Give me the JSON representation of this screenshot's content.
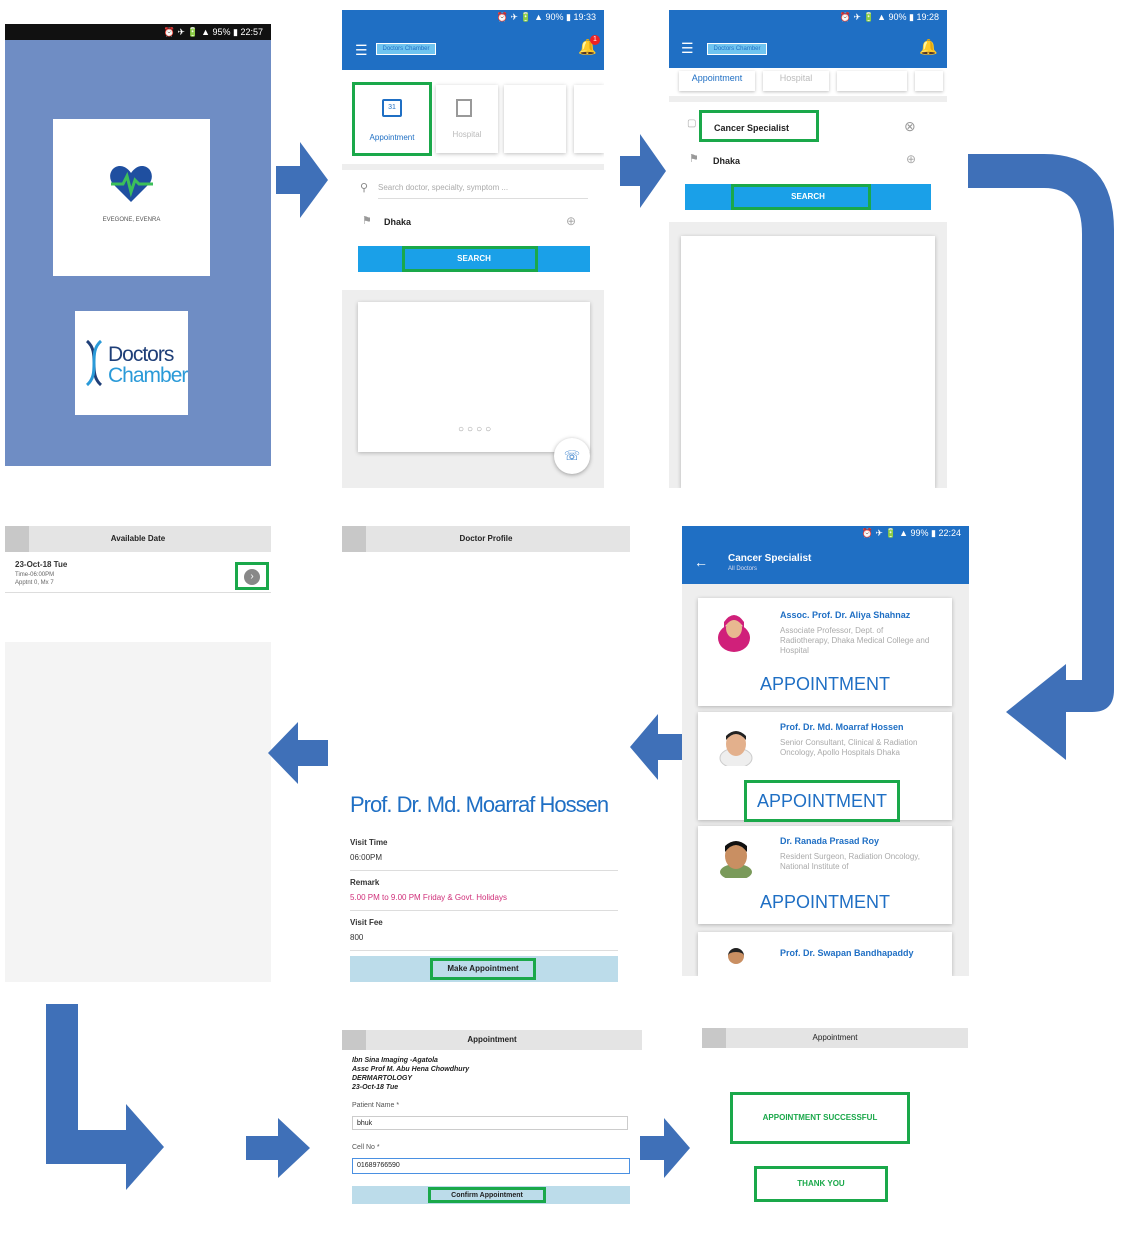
{
  "colors": {
    "accent": "#1f6fc4",
    "highlight": "#1aa84a",
    "search_blue": "#1aa0e8",
    "arrow": "#3f70b8",
    "splash_bg": "#6f8dc4"
  },
  "screen1": {
    "status": "⏰ ✈ 🔋 ▲ 95% ▮ 22:57",
    "logo_tagline": "EVEGONE, EVENRA",
    "brand_line1": "Doctors",
    "brand_line2": "Chamber"
  },
  "screen2": {
    "status": "⏰ ✈ 🔋 ▲ 90% ▮ 19:33",
    "app_title": "Doctors Chamber",
    "notif_count": "1",
    "tab_appointment": "Appointment",
    "tab_hospital": "Hospital",
    "date_badge": "31",
    "search_placeholder": "Search doctor, specialty, symptom ...",
    "location": "Dhaka",
    "search_button": "SEARCH"
  },
  "screen3": {
    "status": "⏰ ✈ 🔋 ▲ 90% ▮ 19:28",
    "app_title": "Doctors Chamber",
    "tab_appointment": "Appointment",
    "tab_hospital": "Hospital",
    "query": "Cancer Specialist",
    "location": "Dhaka",
    "search_button": "SEARCH"
  },
  "screen4": {
    "status": "⏰ ✈ 🔋 ▲ 99% ▮ 22:24",
    "title": "Cancer Specialist",
    "subtitle": "All Doctors",
    "doctors": [
      {
        "name": "Assoc. Prof. Dr. Aliya Shahnaz",
        "desc": "Associate Professor, Dept. of Radiotherapy, Dhaka Medical College and Hospital",
        "action": "APPOINTMENT"
      },
      {
        "name": "Prof. Dr. Md. Moarraf Hossen",
        "desc": "Senior Consultant, Clinical & Radiation Oncology, Apollo Hospitals Dhaka",
        "action": "APPOINTMENT"
      },
      {
        "name": "Dr. Ranada Prasad Roy",
        "desc": "Resident Surgeon, Radiation Oncology, National Institute of",
        "action": "APPOINTMENT"
      },
      {
        "name": "Prof. Dr. Swapan Bandhapaddy",
        "desc": "",
        "action": ""
      }
    ]
  },
  "screen5": {
    "header": "Doctor Profile",
    "doctor_name": "Prof. Dr. Md. Moarraf Hossen",
    "visit_time_label": "Visit Time",
    "visit_time": "06:00PM",
    "remark_label": "Remark",
    "remark": "5.00 PM to 9.00 PM Friday & Govt. Holidays",
    "fee_label": "Visit Fee",
    "fee": "800",
    "button": "Make Appointment"
  },
  "screen6": {
    "header": "Available Date",
    "date": "23-Oct-18 Tue",
    "time": "Time-06:00PM",
    "appt": "Apptnt 0, Mx 7"
  },
  "screen7": {
    "header": "Appointment",
    "info_line1": "Ibn Sina Imaging -Agatola",
    "info_line2": "Assc Prof M. Abu Hena Chowdhury",
    "info_line3": "DERMARTOLOGY",
    "info_line4": "23-Oct-18 Tue",
    "patient_label": "Patient Name *",
    "patient_value": "bhuk",
    "cell_label": "Cell No *",
    "cell_value": "01689766590",
    "button": "Confirm Appointment"
  },
  "screen8": {
    "header": "Appointment",
    "success": "APPOINTMENT SUCCESSFUL",
    "thanks": "THANK YOU"
  }
}
